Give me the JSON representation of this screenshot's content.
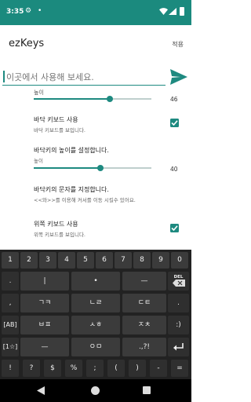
{
  "status": {
    "time": "3:35",
    "gear_icon": "gear-icon",
    "dot": "•"
  },
  "appbar": {
    "title": "ezKeys",
    "apply_label": "적용"
  },
  "input": {
    "placeholder": "이곳에서 사용해 보세요."
  },
  "settings": {
    "row0": {
      "label": "높이",
      "value_label": "46",
      "value": 46
    },
    "row1": {
      "label": "바닥 키보드 사용",
      "sub": "바닥 키보드를 보입니다.",
      "checked": true
    },
    "row2": {
      "label": "바닥키의 높이를 설정합니다.",
      "sub": "높이",
      "value_label": "40",
      "value": 40
    },
    "row3": {
      "label": "바닥키의 문자를 지정합니다.",
      "sub": "<<와>>를 이용해 커서를 이동 시킬수 있어요."
    },
    "row4": {
      "label": "위쪽 키보드 사용",
      "sub": "위쪽 키보드를 보입니다.",
      "checked": true
    }
  },
  "keyboard": {
    "row1": [
      "1",
      "2",
      "3",
      "4",
      "5",
      "6",
      "7",
      "8",
      "9",
      "0"
    ],
    "row2": [
      ".",
      "|",
      "•",
      "—"
    ],
    "row2_del": "DEL",
    "row3": [
      ",",
      "ㄱㅋ",
      "ㄴㄹ",
      "ㄷㅌ",
      "."
    ],
    "row4": [
      "[AB]",
      "ㅂㅍ",
      "ㅅㅎ",
      "ㅈㅊ",
      ":)"
    ],
    "row5": [
      "[1☆]",
      "—",
      "ㅇㅁ",
      ".,?!"
    ],
    "row6": [
      "!",
      "?",
      "$",
      "%",
      ";",
      "(",
      ")",
      "-",
      "="
    ]
  }
}
